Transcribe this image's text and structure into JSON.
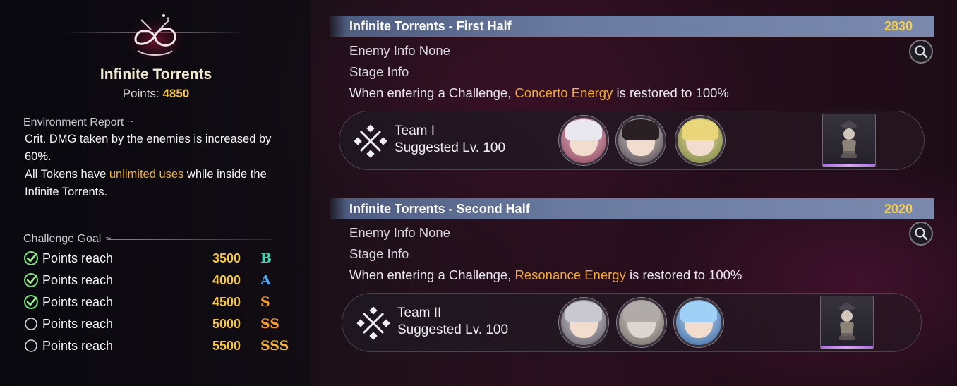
{
  "left": {
    "title": "Infinite Torrents",
    "points_label": "Points:",
    "points_value": "4850",
    "environment": {
      "header": "Environment Report",
      "line1": "Crit. DMG taken by the enemies is increased by 60%.",
      "line2_pre": "All Tokens have ",
      "line2_hl": "unlimited uses",
      "line2_post": " while inside the Infinite Torrents."
    },
    "goals": {
      "header": "Challenge Goal",
      "items": [
        {
          "label": "Points reach",
          "value": "3500",
          "rank": "B",
          "done": true,
          "color": "#3fd7b4"
        },
        {
          "label": "Points reach",
          "value": "4000",
          "rank": "A",
          "done": true,
          "color": "#55a8f0"
        },
        {
          "label": "Points reach",
          "value": "4500",
          "rank": "S",
          "done": true,
          "color": "#f29a35"
        },
        {
          "label": "Points reach",
          "value": "5000",
          "rank": "SS",
          "done": false,
          "color": "#f29a35"
        },
        {
          "label": "Points reach",
          "value": "5500",
          "rank": "SSS",
          "done": false,
          "color": "#f2b23a"
        }
      ]
    }
  },
  "stages": [
    {
      "title": "Infinite Torrents - First Half",
      "score": "2830",
      "enemy_label": "Enemy Info",
      "enemy_value": "None",
      "stage_label": "Stage Info",
      "desc_pre": "When entering a Challenge, ",
      "desc_hl": "Concerto Energy",
      "desc_post": " is restored to 100%",
      "team": {
        "name": "Team I",
        "level": "Suggested Lv. 100"
      }
    },
    {
      "title": "Infinite Torrents - Second Half",
      "score": "2020",
      "enemy_label": "Enemy Info",
      "enemy_value": "None",
      "stage_label": "Stage Info",
      "desc_pre": "When entering a Challenge, ",
      "desc_hl": "Resonance Energy",
      "desc_post": " is restored to 100%",
      "team": {
        "name": "Team II",
        "level": "Suggested Lv. 100"
      }
    }
  ],
  "icons": {
    "search": "magnifier-icon",
    "team": "crossed-swords-icon",
    "check": "check-circle-icon",
    "empty": "empty-circle-icon",
    "boss": "boss-bust-icon"
  },
  "colors": {
    "accent_gold": "#f2c54a",
    "highlight_orange": "#f2a83a",
    "stage_bar": "#6b7ba0",
    "boss_underline": "#c08ae6"
  }
}
